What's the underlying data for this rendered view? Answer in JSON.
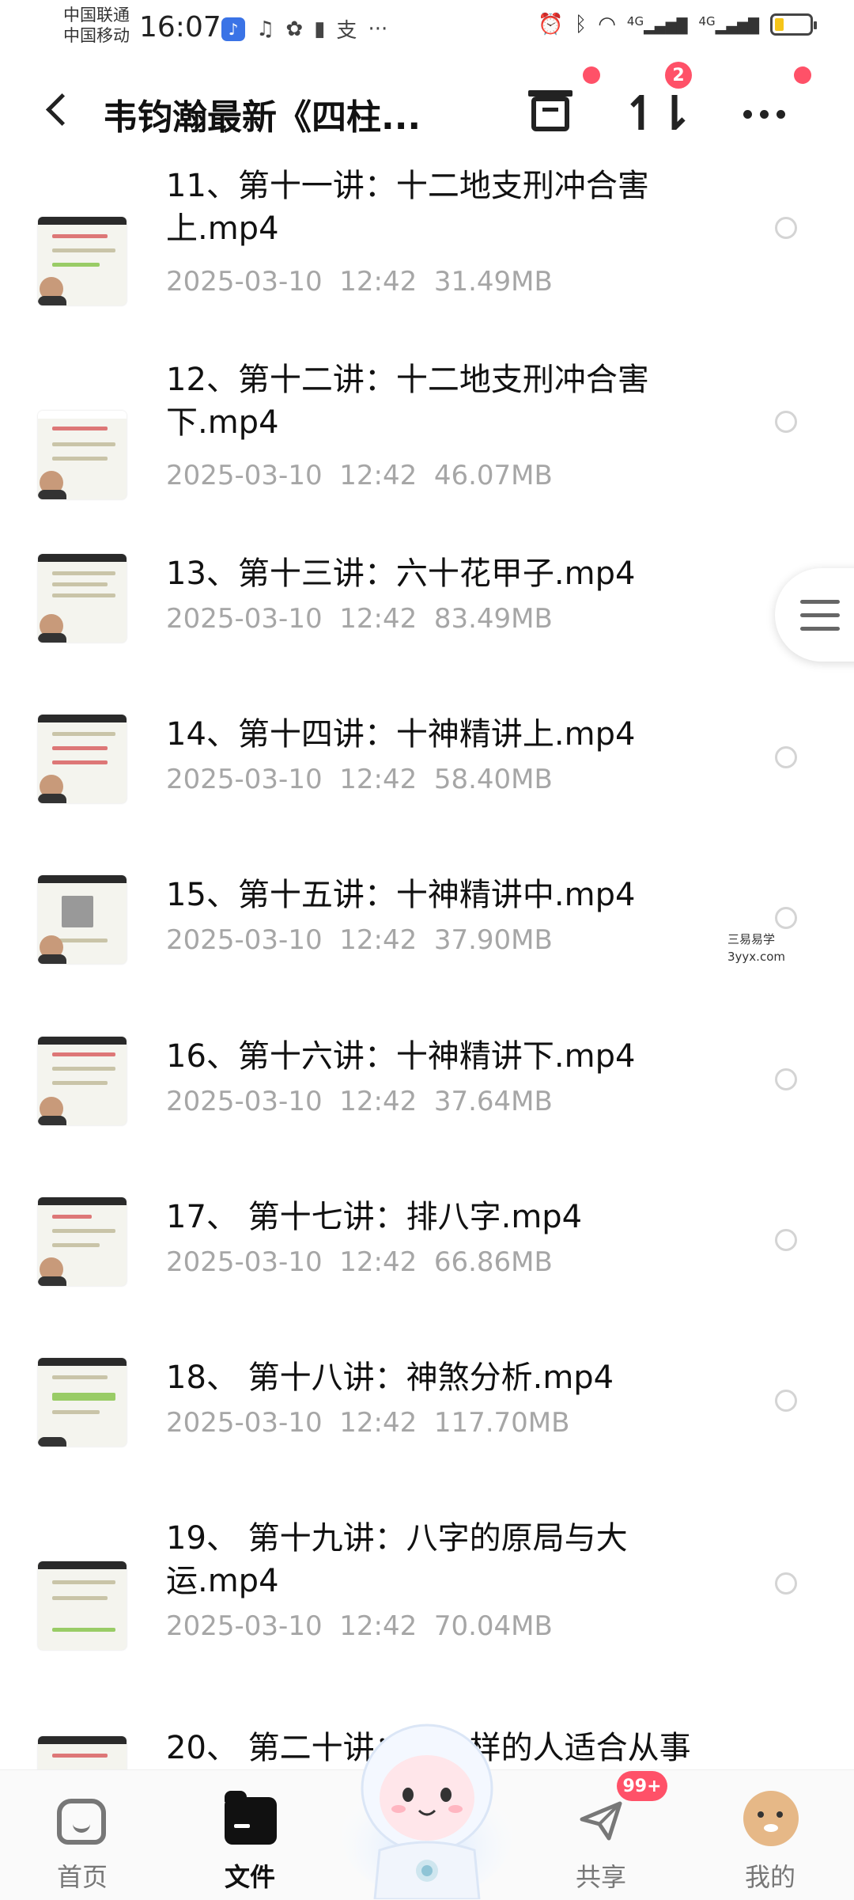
{
  "status_bar": {
    "carrier_1": "中国联通",
    "carrier_2": "中国移动",
    "time": "16:07",
    "app_icons": [
      "bilibili-icon",
      "tiktok-icon",
      "baidu-icon",
      "warning-icon",
      "alipay-icon",
      "more-dots"
    ],
    "more_dots": "···",
    "signal_label_1": "4G",
    "signal_label_2": "4G",
    "battery_fill_fraction": 0.25
  },
  "header": {
    "title": "韦钧瀚最新《四柱...",
    "transfer_badge": "2"
  },
  "files": [
    {
      "name": "11、第十一讲：十二地支刑冲合害上.mp4",
      "date": "2025-03-10",
      "time": "12:42",
      "size": "31.49MB"
    },
    {
      "name": "12、第十二讲：十二地支刑冲合害下.mp4",
      "date": "2025-03-10",
      "time": "12:42",
      "size": "46.07MB"
    },
    {
      "name": "13、第十三讲：六十花甲子.mp4",
      "date": "2025-03-10",
      "time": "12:42",
      "size": "83.49MB"
    },
    {
      "name": "14、第十四讲：十神精讲上.mp4",
      "date": "2025-03-10",
      "time": "12:42",
      "size": "58.40MB"
    },
    {
      "name": "15、第十五讲：十神精讲中.mp4",
      "date": "2025-03-10",
      "time": "12:42",
      "size": "37.90MB"
    },
    {
      "name": "16、第十六讲：十神精讲下.mp4",
      "date": "2025-03-10",
      "time": "12:42",
      "size": "37.64MB"
    },
    {
      "name": "17、 第十七讲：排八字.mp4",
      "date": "2025-03-10",
      "time": "12:42",
      "size": "66.86MB"
    },
    {
      "name": "18、 第十八讲：神煞分析.mp4",
      "date": "2025-03-10",
      "time": "12:42",
      "size": "117.70MB"
    },
    {
      "name": "19、 第十九讲：八字的原局与大运.mp4",
      "date": "2025-03-10",
      "time": "12:42",
      "size": "70.04MB"
    },
    {
      "name": "20、 第二十讲：什么样的人适合从事",
      "date": "",
      "time": "",
      "size": ""
    }
  ],
  "watermark": {
    "line1": "三易易学",
    "line2": "3yyx.com"
  },
  "tabbar": {
    "home": "首页",
    "files": "文件",
    "share": "共享",
    "me": "我的",
    "share_badge": "99+"
  },
  "colors": {
    "accent": "#ff5168",
    "meta_text": "#a6a6a6",
    "primary_text": "#111111"
  }
}
